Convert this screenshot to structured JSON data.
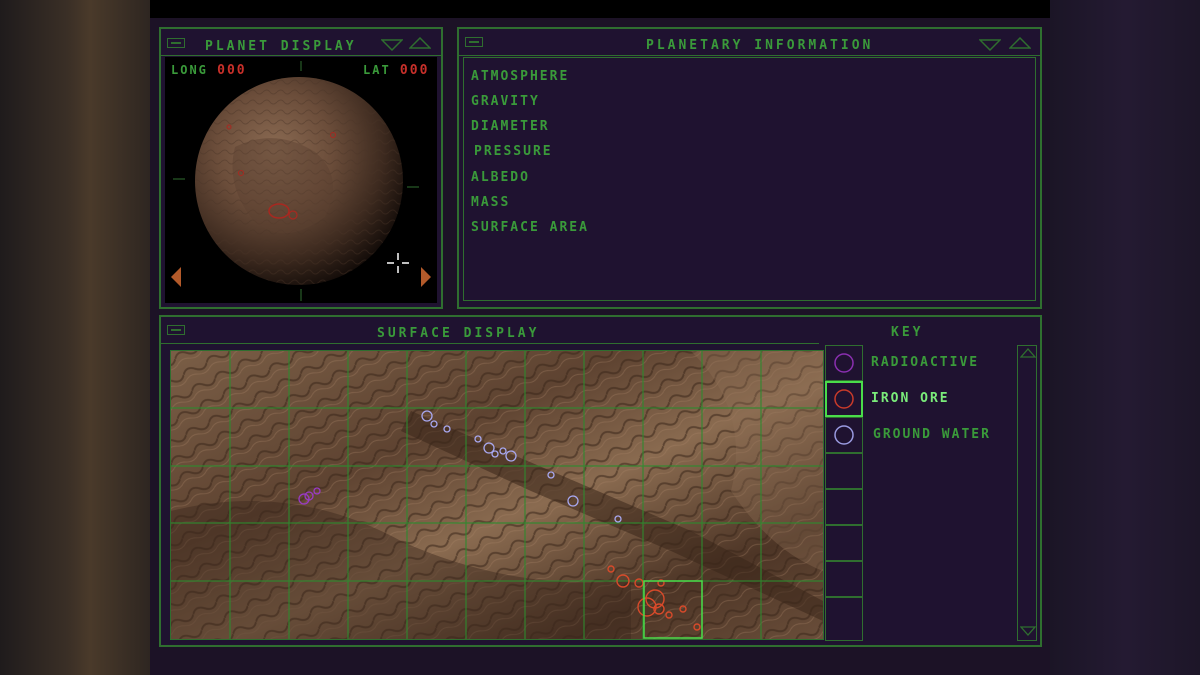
{
  "planet_display": {
    "title": "PLANET DISPLAY",
    "long_label": "LONG",
    "long_value": "000",
    "lat_label": "LAT",
    "lat_value": "000"
  },
  "planetary_information": {
    "title": "PLANETARY INFORMATION",
    "fields": [
      "ATMOSPHERE",
      "GRAVITY",
      "DIAMETER",
      "PRESSURE",
      "ALBEDO",
      "MASS",
      "SURFACE AREA"
    ]
  },
  "surface_display": {
    "title": "SURFACE DISPLAY"
  },
  "key": {
    "title": "KEY",
    "items": [
      {
        "label": "RADIOACTIVE",
        "color": "#8a2fb0"
      },
      {
        "label": "IRON ORE",
        "color": "#c83a2a",
        "selected": true
      },
      {
        "label": "GROUND WATER",
        "color": "#9a9ae0"
      }
    ]
  },
  "colors": {
    "frame_green": "#2f6e2f",
    "text_green": "#3a9a3a",
    "highlight_green": "#6adc6a",
    "panel_purple": "#1f1230",
    "value_red": "#c8302a"
  }
}
